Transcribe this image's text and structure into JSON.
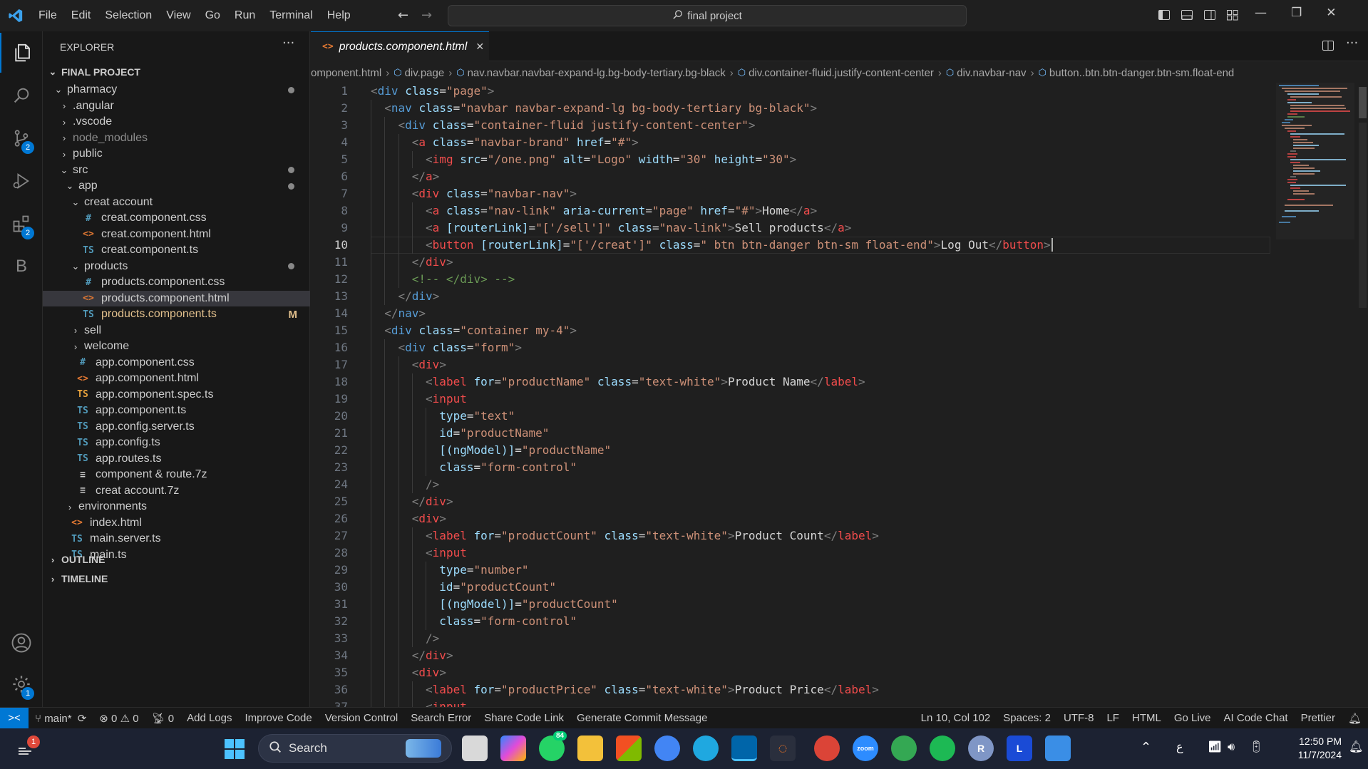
{
  "menu": [
    "File",
    "Edit",
    "Selection",
    "View",
    "Go",
    "Run",
    "Terminal",
    "Help"
  ],
  "command_center": "final project",
  "activity_badges": {
    "scm": "2",
    "extensions": "2",
    "settings": "1"
  },
  "explorer": {
    "title": "EXPLORER",
    "section": "FINAL PROJECT",
    "items": [
      {
        "label": "pharmacy",
        "depth": 1,
        "type": "folder-open",
        "mod": "dot"
      },
      {
        "label": ".angular",
        "depth": 2,
        "type": "folder"
      },
      {
        "label": ".vscode",
        "depth": 2,
        "type": "folder"
      },
      {
        "label": "node_modules",
        "depth": 2,
        "type": "folder",
        "dim": true
      },
      {
        "label": "public",
        "depth": 2,
        "type": "folder"
      },
      {
        "label": "src",
        "depth": 2,
        "type": "folder-open",
        "mod": "dot"
      },
      {
        "label": "app",
        "depth": 3,
        "type": "folder-open",
        "mod": "dot"
      },
      {
        "label": "creat account",
        "depth": 4,
        "type": "folder-open"
      },
      {
        "label": "creat.component.css",
        "depth": 5,
        "type": "css"
      },
      {
        "label": "creat.component.html",
        "depth": 5,
        "type": "html"
      },
      {
        "label": "creat.component.ts",
        "depth": 5,
        "type": "ts"
      },
      {
        "label": "products",
        "depth": 4,
        "type": "folder-open",
        "mod": "dot"
      },
      {
        "label": "products.component.css",
        "depth": 5,
        "type": "css"
      },
      {
        "label": "products.component.html",
        "depth": 5,
        "type": "html",
        "selected": true
      },
      {
        "label": "products.component.ts",
        "depth": 5,
        "type": "ts",
        "mod": "M"
      },
      {
        "label": "sell",
        "depth": 4,
        "type": "folder"
      },
      {
        "label": "welcome",
        "depth": 4,
        "type": "folder"
      },
      {
        "label": "app.component.css",
        "depth": 4,
        "type": "css"
      },
      {
        "label": "app.component.html",
        "depth": 4,
        "type": "html"
      },
      {
        "label": "app.component.spec.ts",
        "depth": 4,
        "type": "ts-spec"
      },
      {
        "label": "app.component.ts",
        "depth": 4,
        "type": "ts"
      },
      {
        "label": "app.config.server.ts",
        "depth": 4,
        "type": "ts"
      },
      {
        "label": "app.config.ts",
        "depth": 4,
        "type": "ts"
      },
      {
        "label": "app.routes.ts",
        "depth": 4,
        "type": "ts"
      },
      {
        "label": "component & route.7z",
        "depth": 4,
        "type": "zip"
      },
      {
        "label": "creat account.7z",
        "depth": 4,
        "type": "zip"
      },
      {
        "label": "environments",
        "depth": 3,
        "type": "folder"
      },
      {
        "label": "index.html",
        "depth": 3,
        "type": "html"
      },
      {
        "label": "main.server.ts",
        "depth": 3,
        "type": "ts"
      },
      {
        "label": "main.ts",
        "depth": 3,
        "type": "ts"
      }
    ],
    "outline": "OUTLINE",
    "timeline": "TIMELINE"
  },
  "file_icons": {
    "css": "#",
    "html": "<>",
    "ts": "TS",
    "ts-spec": "TS",
    "zip": "≡"
  },
  "file_icon_colors": {
    "css": "#519aba",
    "html": "#e37933",
    "ts": "#519aba",
    "ts-spec": "#e8a33d",
    "zip": "#cccccc"
  },
  "tab": {
    "label": "products.component.html",
    "close": "✕"
  },
  "breadcrumbs": [
    "omponent.html",
    "div.page",
    "nav.navbar.navbar-expand-lg.bg-body-tertiary.bg-black",
    "div.container-fluid.justify-content-center",
    "div.navbar-nav",
    "button..btn.btn-danger.btn-sm.float-end"
  ],
  "current_line": 10,
  "code_lines": [
    {
      "i": 0,
      "t": [
        [
          "br",
          "<"
        ],
        [
          "tag",
          "div"
        ],
        [
          "t",
          " "
        ],
        [
          "attr",
          "class"
        ],
        [
          "t",
          "="
        ],
        [
          "str",
          "\"page\""
        ],
        [
          "br",
          ">"
        ]
      ]
    },
    {
      "i": 1,
      "t": [
        [
          "br",
          "<"
        ],
        [
          "tag",
          "nav"
        ],
        [
          "t",
          " "
        ],
        [
          "attr",
          "class"
        ],
        [
          "t",
          "="
        ],
        [
          "str",
          "\"navbar navbar-expand-lg bg-body-tertiary bg-black\""
        ],
        [
          "br",
          ">"
        ]
      ]
    },
    {
      "i": 2,
      "t": [
        [
          "br",
          "<"
        ],
        [
          "tag",
          "div"
        ],
        [
          "t",
          " "
        ],
        [
          "attr",
          "class"
        ],
        [
          "t",
          "="
        ],
        [
          "str",
          "\"container-fluid justify-content-center\""
        ],
        [
          "br",
          ">"
        ]
      ]
    },
    {
      "i": 3,
      "t": [
        [
          "br",
          "<"
        ],
        [
          "tag2",
          "a"
        ],
        [
          "t",
          " "
        ],
        [
          "attr",
          "class"
        ],
        [
          "t",
          "="
        ],
        [
          "str",
          "\"navbar-brand\""
        ],
        [
          "t",
          " "
        ],
        [
          "attr",
          "href"
        ],
        [
          "t",
          "="
        ],
        [
          "str",
          "\"#\""
        ],
        [
          "br",
          ">"
        ]
      ]
    },
    {
      "i": 4,
      "t": [
        [
          "br",
          "<"
        ],
        [
          "tag2",
          "img"
        ],
        [
          "t",
          " "
        ],
        [
          "attr",
          "src"
        ],
        [
          "t",
          "="
        ],
        [
          "str",
          "\"/one.png\""
        ],
        [
          "t",
          " "
        ],
        [
          "attr",
          "alt"
        ],
        [
          "t",
          "="
        ],
        [
          "str",
          "\"Logo\""
        ],
        [
          "t",
          " "
        ],
        [
          "attr",
          "width"
        ],
        [
          "t",
          "="
        ],
        [
          "str",
          "\"30\""
        ],
        [
          "t",
          " "
        ],
        [
          "attr",
          "height"
        ],
        [
          "t",
          "="
        ],
        [
          "str",
          "\"30\""
        ],
        [
          "br",
          ">"
        ]
      ]
    },
    {
      "i": 3,
      "t": [
        [
          "br",
          "</"
        ],
        [
          "tag2",
          "a"
        ],
        [
          "br",
          ">"
        ]
      ]
    },
    {
      "i": 3,
      "t": [
        [
          "br",
          "<"
        ],
        [
          "tag2",
          "div"
        ],
        [
          "t",
          " "
        ],
        [
          "attr",
          "class"
        ],
        [
          "t",
          "="
        ],
        [
          "str",
          "\"navbar-nav\""
        ],
        [
          "br",
          ">"
        ]
      ]
    },
    {
      "i": 4,
      "t": [
        [
          "br",
          "<"
        ],
        [
          "tag2",
          "a"
        ],
        [
          "t",
          " "
        ],
        [
          "attr",
          "class"
        ],
        [
          "t",
          "="
        ],
        [
          "str",
          "\"nav-link\""
        ],
        [
          "t",
          " "
        ],
        [
          "attr",
          "aria-current"
        ],
        [
          "t",
          "="
        ],
        [
          "str",
          "\"page\""
        ],
        [
          "t",
          " "
        ],
        [
          "attr",
          "href"
        ],
        [
          "t",
          "="
        ],
        [
          "str",
          "\"#\""
        ],
        [
          "br",
          ">"
        ],
        [
          "t",
          "Home"
        ],
        [
          "br",
          "</"
        ],
        [
          "tag2",
          "a"
        ],
        [
          "br",
          ">"
        ]
      ]
    },
    {
      "i": 4,
      "t": [
        [
          "br",
          "<"
        ],
        [
          "tag2",
          "a"
        ],
        [
          "t",
          " "
        ],
        [
          "attr",
          "[routerLink]"
        ],
        [
          "t",
          "="
        ],
        [
          "str",
          "\"['/sell']\""
        ],
        [
          "t",
          " "
        ],
        [
          "attr",
          "class"
        ],
        [
          "t",
          "="
        ],
        [
          "str",
          "\"nav-link\""
        ],
        [
          "br",
          ">"
        ],
        [
          "t",
          "Sell products"
        ],
        [
          "br",
          "</"
        ],
        [
          "tag2",
          "a"
        ],
        [
          "br",
          ">"
        ]
      ]
    },
    {
      "i": 4,
      "t": [
        [
          "br",
          "<"
        ],
        [
          "tag2",
          "button"
        ],
        [
          "t",
          " "
        ],
        [
          "attr",
          "[routerLink]"
        ],
        [
          "t",
          "="
        ],
        [
          "str",
          "\"['/creat']\""
        ],
        [
          "t",
          " "
        ],
        [
          "attr",
          "class"
        ],
        [
          "t",
          "="
        ],
        [
          "str",
          "\" btn btn-danger btn-sm float-end\""
        ],
        [
          "br",
          ">"
        ],
        [
          "t",
          "Log Out"
        ],
        [
          "br",
          "</"
        ],
        [
          "tag2",
          "button"
        ],
        [
          "br",
          ">"
        ]
      ]
    },
    {
      "i": 3,
      "t": [
        [
          "br",
          "</"
        ],
        [
          "tag2",
          "div"
        ],
        [
          "br",
          ">"
        ]
      ]
    },
    {
      "i": 3,
      "t": [
        [
          "com",
          "<!-- </div> -->"
        ]
      ]
    },
    {
      "i": 2,
      "t": [
        [
          "br",
          "</"
        ],
        [
          "tag",
          "div"
        ],
        [
          "br",
          ">"
        ]
      ]
    },
    {
      "i": 1,
      "t": [
        [
          "br",
          "</"
        ],
        [
          "tag",
          "nav"
        ],
        [
          "br",
          ">"
        ]
      ]
    },
    {
      "i": 1,
      "t": [
        [
          "br",
          "<"
        ],
        [
          "tag",
          "div"
        ],
        [
          "t",
          " "
        ],
        [
          "attr",
          "class"
        ],
        [
          "t",
          "="
        ],
        [
          "str",
          "\"container my-4\""
        ],
        [
          "br",
          ">"
        ]
      ]
    },
    {
      "i": 2,
      "t": [
        [
          "br",
          "<"
        ],
        [
          "tag",
          "div"
        ],
        [
          "t",
          " "
        ],
        [
          "attr",
          "class"
        ],
        [
          "t",
          "="
        ],
        [
          "str",
          "\"form\""
        ],
        [
          "br",
          ">"
        ]
      ]
    },
    {
      "i": 3,
      "t": [
        [
          "br",
          "<"
        ],
        [
          "tag2",
          "div"
        ],
        [
          "br",
          ">"
        ]
      ]
    },
    {
      "i": 4,
      "t": [
        [
          "br",
          "<"
        ],
        [
          "tag2",
          "label"
        ],
        [
          "t",
          " "
        ],
        [
          "attr",
          "for"
        ],
        [
          "t",
          "="
        ],
        [
          "str",
          "\"productName\""
        ],
        [
          "t",
          " "
        ],
        [
          "attr",
          "class"
        ],
        [
          "t",
          "="
        ],
        [
          "str",
          "\"text-white\""
        ],
        [
          "br",
          ">"
        ],
        [
          "t",
          "Product Name"
        ],
        [
          "br",
          "</"
        ],
        [
          "tag2",
          "label"
        ],
        [
          "br",
          ">"
        ]
      ]
    },
    {
      "i": 4,
      "t": [
        [
          "br",
          "<"
        ],
        [
          "tag2",
          "input"
        ]
      ]
    },
    {
      "i": 5,
      "t": [
        [
          "attr",
          "type"
        ],
        [
          "t",
          "="
        ],
        [
          "str",
          "\"text\""
        ]
      ]
    },
    {
      "i": 5,
      "t": [
        [
          "attr",
          "id"
        ],
        [
          "t",
          "="
        ],
        [
          "str",
          "\"productName\""
        ]
      ]
    },
    {
      "i": 5,
      "t": [
        [
          "attr",
          "[(ngModel)]"
        ],
        [
          "t",
          "="
        ],
        [
          "str",
          "\"productName\""
        ]
      ]
    },
    {
      "i": 5,
      "t": [
        [
          "attr",
          "class"
        ],
        [
          "t",
          "="
        ],
        [
          "str",
          "\"form-control\""
        ]
      ]
    },
    {
      "i": 4,
      "t": [
        [
          "br",
          "/>"
        ]
      ]
    },
    {
      "i": 3,
      "t": [
        [
          "br",
          "</"
        ],
        [
          "tag2",
          "div"
        ],
        [
          "br",
          ">"
        ]
      ]
    },
    {
      "i": 3,
      "t": [
        [
          "br",
          "<"
        ],
        [
          "tag2",
          "div"
        ],
        [
          "br",
          ">"
        ]
      ]
    },
    {
      "i": 4,
      "t": [
        [
          "br",
          "<"
        ],
        [
          "tag2",
          "label"
        ],
        [
          "t",
          " "
        ],
        [
          "attr",
          "for"
        ],
        [
          "t",
          "="
        ],
        [
          "str",
          "\"productCount\""
        ],
        [
          "t",
          " "
        ],
        [
          "attr",
          "class"
        ],
        [
          "t",
          "="
        ],
        [
          "str",
          "\"text-white\""
        ],
        [
          "br",
          ">"
        ],
        [
          "t",
          "Product Count"
        ],
        [
          "br",
          "</"
        ],
        [
          "tag2",
          "label"
        ],
        [
          "br",
          ">"
        ]
      ]
    },
    {
      "i": 4,
      "t": [
        [
          "br",
          "<"
        ],
        [
          "tag2",
          "input"
        ]
      ]
    },
    {
      "i": 5,
      "t": [
        [
          "attr",
          "type"
        ],
        [
          "t",
          "="
        ],
        [
          "str",
          "\"number\""
        ]
      ]
    },
    {
      "i": 5,
      "t": [
        [
          "attr",
          "id"
        ],
        [
          "t",
          "="
        ],
        [
          "str",
          "\"productCount\""
        ]
      ]
    },
    {
      "i": 5,
      "t": [
        [
          "attr",
          "[(ngModel)]"
        ],
        [
          "t",
          "="
        ],
        [
          "str",
          "\"productCount\""
        ]
      ]
    },
    {
      "i": 5,
      "t": [
        [
          "attr",
          "class"
        ],
        [
          "t",
          "="
        ],
        [
          "str",
          "\"form-control\""
        ]
      ]
    },
    {
      "i": 4,
      "t": [
        [
          "br",
          "/>"
        ]
      ]
    },
    {
      "i": 3,
      "t": [
        [
          "br",
          "</"
        ],
        [
          "tag2",
          "div"
        ],
        [
          "br",
          ">"
        ]
      ]
    },
    {
      "i": 3,
      "t": [
        [
          "br",
          "<"
        ],
        [
          "tag2",
          "div"
        ],
        [
          "br",
          ">"
        ]
      ]
    },
    {
      "i": 4,
      "t": [
        [
          "br",
          "<"
        ],
        [
          "tag2",
          "label"
        ],
        [
          "t",
          " "
        ],
        [
          "attr",
          "for"
        ],
        [
          "t",
          "="
        ],
        [
          "str",
          "\"productPrice\""
        ],
        [
          "t",
          " "
        ],
        [
          "attr",
          "class"
        ],
        [
          "t",
          "="
        ],
        [
          "str",
          "\"text-white\""
        ],
        [
          "br",
          ">"
        ],
        [
          "t",
          "Product Price"
        ],
        [
          "br",
          "</"
        ],
        [
          "tag2",
          "label"
        ],
        [
          "br",
          ">"
        ]
      ]
    },
    {
      "i": 4,
      "t": [
        [
          "br",
          "<"
        ],
        [
          "tag2",
          "input"
        ]
      ]
    }
  ],
  "status": {
    "branch": "main*",
    "errors": "0",
    "warnings": "0",
    "ports": "0",
    "left_items": [
      "Add Logs",
      "Improve Code",
      "Version Control",
      "Search Error",
      "Share Code Link",
      "Generate Commit Message"
    ],
    "right_items": [
      "Ln 10, Col 102",
      "Spaces: 2",
      "UTF-8",
      "LF",
      "HTML",
      "Go Live",
      "AI Code Chat",
      "Prettier"
    ]
  },
  "taskbar": {
    "search": "Search",
    "notification_badge": "1",
    "whatsapp_badge": "84",
    "time": "12:50 PM",
    "date": "11/7/2024",
    "lang": "ع"
  },
  "colors": {
    "accent": "#0078d4",
    "editor_bg": "#1f1f1f",
    "sidebar_bg": "#181818",
    "modified": "#e2c08d"
  }
}
